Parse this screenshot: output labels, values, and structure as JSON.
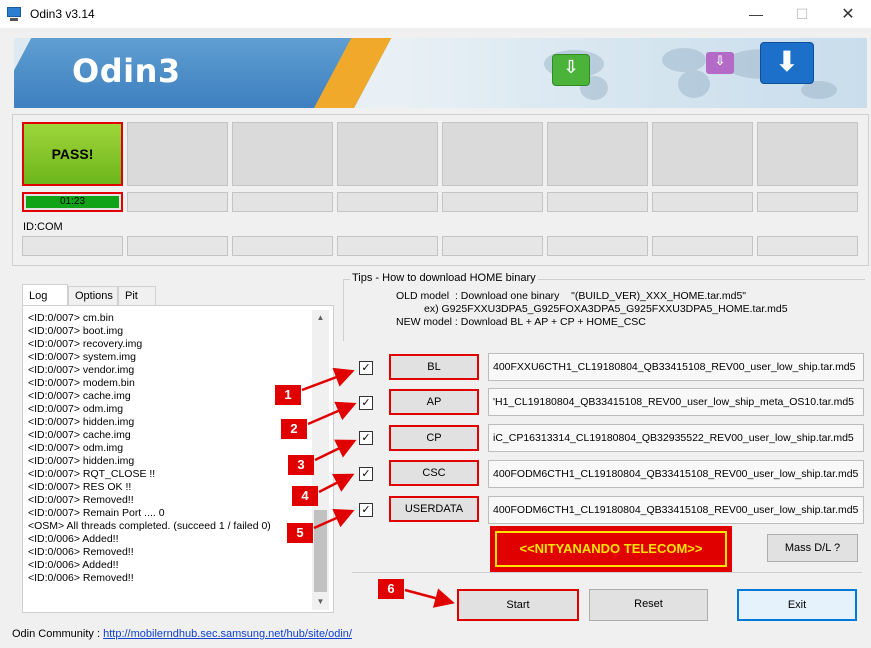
{
  "window": {
    "title": "Odin3 v3.14",
    "minimize": "—",
    "maximize": "☐",
    "close": "✕"
  },
  "banner": {
    "logo": "Odin3"
  },
  "ports": {
    "status": "PASS!",
    "timer": "01:23",
    "id_com_label": "ID:COM"
  },
  "tabs": [
    {
      "label": "Log"
    },
    {
      "label": "Options"
    },
    {
      "label": "Pit"
    }
  ],
  "log": [
    "<ID:0/007> cm.bin",
    "<ID:0/007> boot.img",
    "<ID:0/007> recovery.img",
    "<ID:0/007> system.img",
    "<ID:0/007> vendor.img",
    "<ID:0/007> modem.bin",
    "<ID:0/007> cache.img",
    "<ID:0/007> odm.img",
    "<ID:0/007> hidden.img",
    "<ID:0/007> cache.img",
    "<ID:0/007> odm.img",
    "<ID:0/007> hidden.img",
    "<ID:0/007> RQT_CLOSE !!",
    "<ID:0/007> RES OK !!",
    "<ID:0/007> Removed!!",
    "<ID:0/007> Remain Port ....  0",
    "<OSM> All threads completed. (succeed 1 / failed 0)",
    "<ID:0/006> Added!!",
    "<ID:0/006> Removed!!",
    "<ID:0/006> Added!!",
    "<ID:0/006> Removed!!"
  ],
  "community": {
    "label": "Odin Community : ",
    "link": "http://mobilerndhub.sec.samsung.net/hub/site/odin/"
  },
  "tips": {
    "title": "Tips - How to download HOME binary",
    "line1": "OLD model  : Download one binary    \"(BUILD_VER)_XXX_HOME.tar.md5\"",
    "line2": "ex) G925FXXU3DPA5_G925FOXA3DPA5_G925FXXU3DPA5_HOME.tar.md5",
    "line3": "NEW model : Download BL + AP + CP + HOME_CSC"
  },
  "files": [
    {
      "checked": "✓",
      "button": "BL",
      "path": "400FXXU6CTH1_CL19180804_QB33415108_REV00_user_low_ship.tar.md5",
      "marker": "1"
    },
    {
      "checked": "✓",
      "button": "AP",
      "path": "'H1_CL19180804_QB33415108_REV00_user_low_ship_meta_OS10.tar.md5",
      "marker": "2"
    },
    {
      "checked": "✓",
      "button": "CP",
      "path": "iC_CP16313314_CL19180804_QB32935522_REV00_user_low_ship.tar.md5",
      "marker": "3"
    },
    {
      "checked": "✓",
      "button": "CSC",
      "path": "400FODM6CTH1_CL19180804_QB33415108_REV00_user_low_ship.tar.md5",
      "marker": "4"
    },
    {
      "checked": "✓",
      "button": "USERDATA",
      "path": "400FODM6CTH1_CL19180804_QB33415108_REV00_user_low_ship.tar.md5",
      "marker": "5"
    }
  ],
  "watermark": "<<NITYANANDO TELECOM>>",
  "mass_dl": "Mass D/L ?",
  "actions": {
    "start": "Start",
    "reset": "Reset",
    "exit": "Exit",
    "start_marker": "6"
  },
  "colors": {
    "pass_green": "#7cc22a",
    "highlight_red": "#e00000",
    "exit_blue": "#0078d7",
    "timer_green": "#10a318"
  }
}
